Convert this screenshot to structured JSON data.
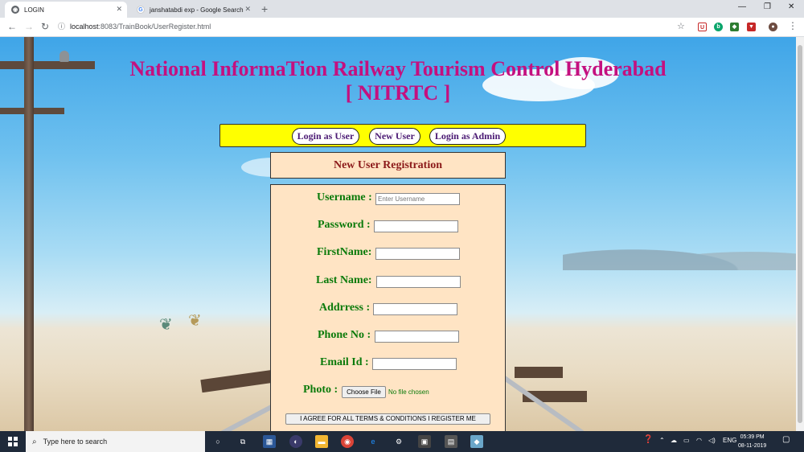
{
  "browser": {
    "tabs": [
      {
        "title": "LOGIN",
        "active": true
      },
      {
        "title": "janshatabdi exp - Google Search",
        "active": false
      }
    ],
    "new_tab": "+",
    "window_controls": [
      "—",
      "❐",
      "✕"
    ],
    "url_prefix": "localhost",
    "url_rest": ":8083/TrainBook/UserRegister.html"
  },
  "page": {
    "title": "National InformaTion Railway Tourism Control Hyderabad",
    "subtitle": "[ NITRTC ]",
    "menu": {
      "login_user": "Login as User",
      "new_user": "New User",
      "login_admin": "Login as Admin"
    },
    "registration_header": "New User Registration",
    "form": {
      "username_label": "Username :",
      "username_placeholder": "Enter Username",
      "password_label": "Password :",
      "firstname_label": "FirstName:",
      "lastname_label": "Last Name:",
      "address_label": "Addrress :",
      "phone_label": "Phone No :",
      "email_label": "Email Id :",
      "photo_label": "Photo :",
      "choose_file": "Choose File",
      "no_file": "No file chosen",
      "agree_button": "I AGREE FOR ALL TERMS & CONDITIONS I REGISTER ME"
    }
  },
  "taskbar": {
    "search_placeholder": "Type here to search",
    "language": "ENG",
    "time": "05:39 PM",
    "date": "08-11-2019"
  },
  "colors": {
    "title": "#c4107f",
    "menubar": "#ffff00",
    "form_bg": "#ffe4c4",
    "label_green": "#0a7a0a"
  }
}
